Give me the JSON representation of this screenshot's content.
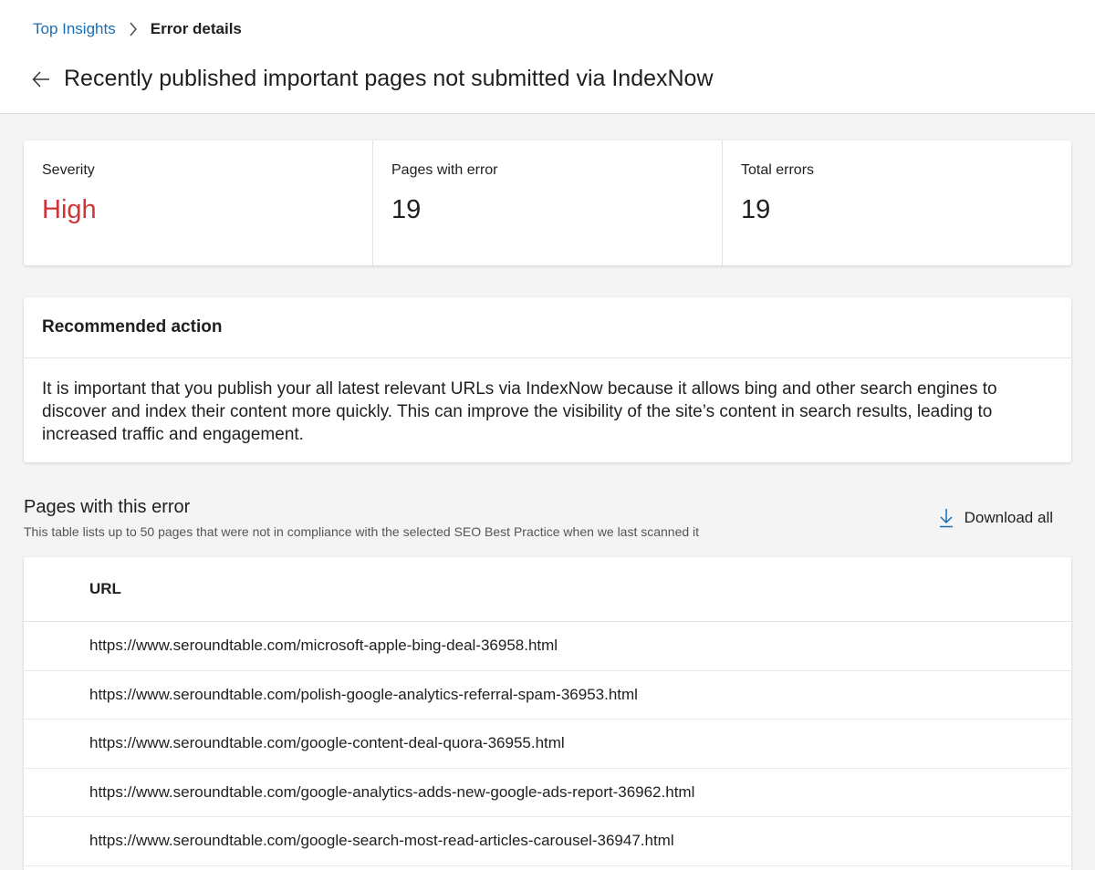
{
  "breadcrumb": {
    "parent": "Top Insights",
    "current": "Error details"
  },
  "page": {
    "title": "Recently published important pages not submitted via IndexNow"
  },
  "stats": [
    {
      "label": "Severity",
      "value": "High"
    },
    {
      "label": "Pages with error",
      "value": "19"
    },
    {
      "label": "Total errors",
      "value": "19"
    }
  ],
  "recommended": {
    "heading": "Recommended action",
    "text": "It is important that you publish your all latest relevant URLs via IndexNow because it allows bing and other search engines to discover and index their content more quickly. This can improve the visibility of the site’s content in search results, leading to increased traffic and engagement."
  },
  "pages": {
    "title": "Pages with this error",
    "subtitle": "This table lists up to 50 pages that were not in compliance with the selected SEO Best Practice when we last scanned it",
    "download_label": "Download all"
  },
  "table": {
    "column": "URL",
    "rows": [
      "https://www.seroundtable.com/microsoft-apple-bing-deal-36958.html",
      "https://www.seroundtable.com/polish-google-analytics-referral-spam-36953.html",
      "https://www.seroundtable.com/google-content-deal-quora-36955.html",
      "https://www.seroundtable.com/google-analytics-adds-new-google-ads-report-36962.html",
      "https://www.seroundtable.com/google-search-most-read-articles-carousel-36947.html"
    ]
  },
  "colors": {
    "link": "#1a6fb5",
    "severity_high": "#d13438",
    "accent_icon": "#1a6fb5"
  },
  "icons": {
    "breadcrumb_separator": "chevron-right-icon",
    "back": "arrow-left-icon",
    "download": "download-icon"
  }
}
